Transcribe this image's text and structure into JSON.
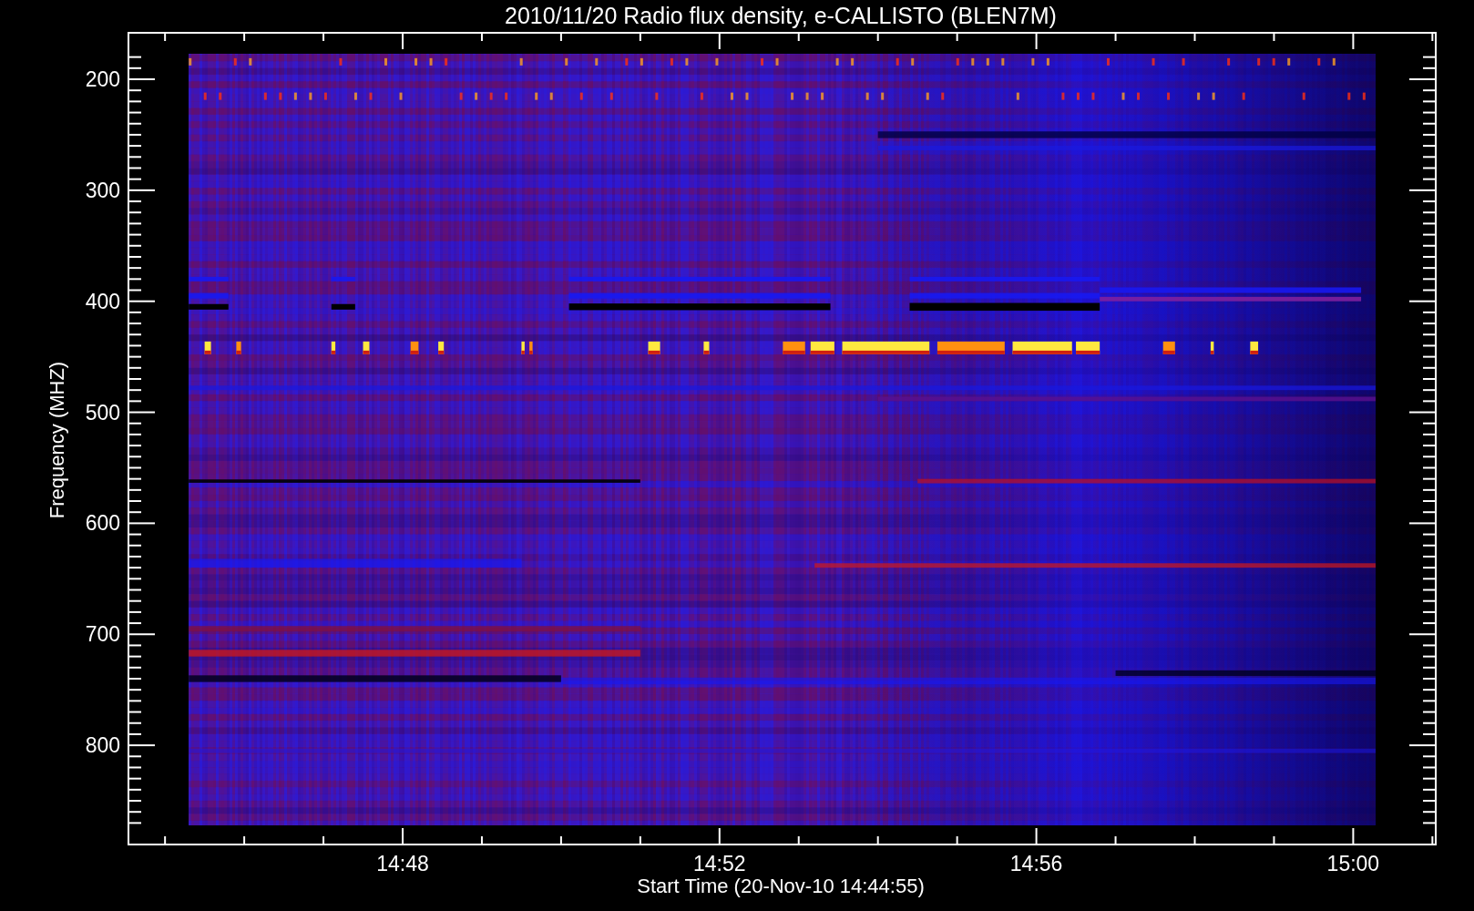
{
  "plot": {
    "title": "2010/11/20  Radio flux density, e-CALLISTO (BLEN7M)",
    "y_axis": {
      "label": "Frequency (MHZ)",
      "ticks": [
        "200",
        "300",
        "400",
        "500",
        "600",
        "700",
        "800"
      ]
    },
    "x_axis": {
      "label": "Start Time (20-Nov-10 14:44:55)",
      "ticks": [
        "14:48",
        "14:52",
        "14:56",
        "15:00"
      ]
    }
  }
}
